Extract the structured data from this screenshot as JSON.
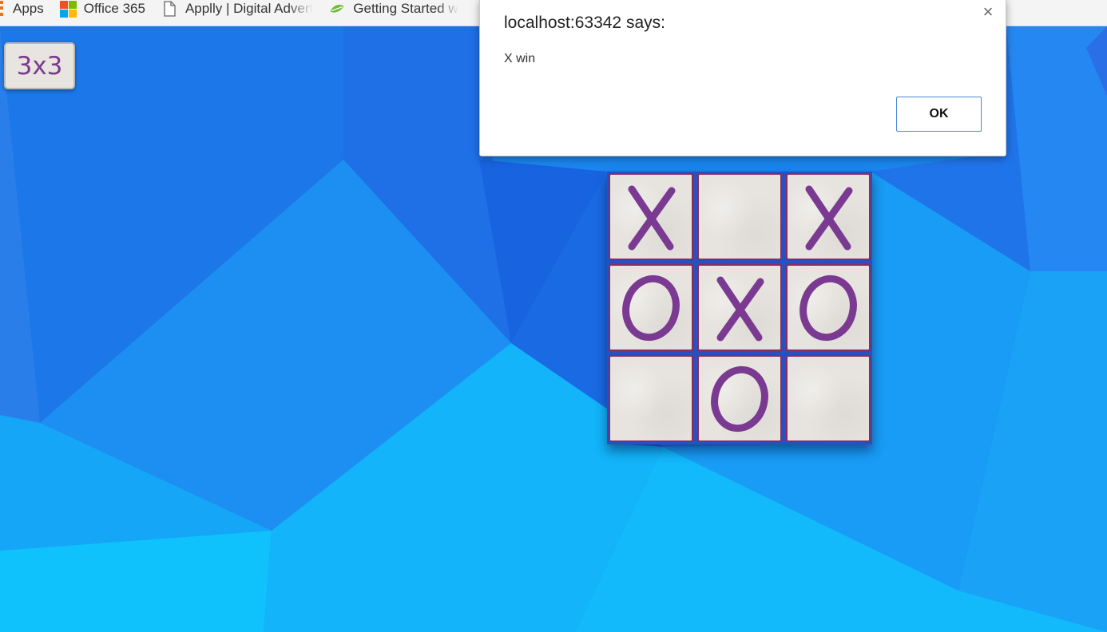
{
  "bookmarks": [
    {
      "label": "Apps",
      "icon": "apps-grid-icon"
    },
    {
      "label": "Office 365",
      "icon": "microsoft-logo-icon"
    },
    {
      "label": "Applly | Digital Advert",
      "icon": "page-icon"
    },
    {
      "label": "Getting Started w",
      "icon": "green-leaf-icon"
    }
  ],
  "game": {
    "size_button_label": "3x3",
    "board": [
      [
        "X",
        "",
        "X"
      ],
      [
        "O",
        "X",
        "O"
      ],
      [
        "",
        "O",
        ""
      ]
    ],
    "mark_color": "#7b3a91",
    "cell_border_color": "#8a2d5e"
  },
  "dialog": {
    "title": "localhost:63342 says:",
    "message": "X win",
    "ok_label": "OK",
    "close_symbol": "×"
  },
  "colors": {
    "background_primary": "#1a8cf0",
    "dialog_button_border": "#4a88d8"
  }
}
